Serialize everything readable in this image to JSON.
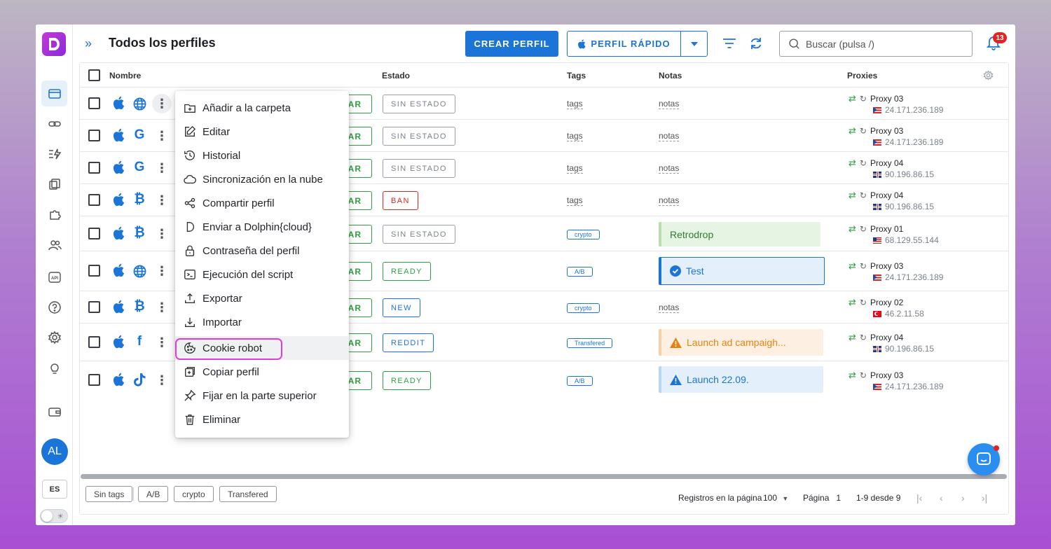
{
  "header": {
    "title": "Todos los perfiles",
    "create_label": "CREAR PERFIL",
    "quick_label": "PERFIL RÁPIDO",
    "search_placeholder": "Buscar (pulsa /)",
    "notifications": "13"
  },
  "sidebar": {
    "avatar": "AL",
    "lang": "ES"
  },
  "columns": {
    "name": "Nombre",
    "status": "Estado",
    "tags": "Tags",
    "notes": "Notas",
    "proxies": "Proxies"
  },
  "start_label": "AR",
  "rows": [
    {
      "site": "globe",
      "status": "SIN ESTADO",
      "tags": "tags",
      "notes": "notas",
      "proxy": "Proxy 03",
      "ip": "24.171.236.189",
      "flag": "pr"
    },
    {
      "site": "google",
      "status": "SIN ESTADO",
      "tags": "tags",
      "notes": "notas",
      "proxy": "Proxy 03",
      "ip": "24.171.236.189",
      "flag": "pr"
    },
    {
      "site": "google",
      "status": "SIN ESTADO",
      "tags": "tags",
      "notes": "notas",
      "proxy": "Proxy 04",
      "ip": "90.196.86.15",
      "flag": "uk"
    },
    {
      "site": "bitcoin",
      "status": "BAN",
      "tags": "tags",
      "notes": "notas",
      "proxy": "Proxy 04",
      "ip": "90.196.86.15",
      "flag": "uk"
    },
    {
      "site": "bitcoin",
      "status": "SIN ESTADO",
      "tags": "crypto",
      "notes": "Retrodrop",
      "proxy": "Proxy 01",
      "ip": "68.129.55.144",
      "flag": "us"
    },
    {
      "site": "globe",
      "status": "READY",
      "tags": "A/B",
      "notes": "Test",
      "proxy": "Proxy 03",
      "ip": "24.171.236.189",
      "flag": "pr"
    },
    {
      "site": "bitcoin",
      "status": "NEW",
      "tags": "crypto",
      "notes": "notas",
      "proxy": "Proxy 02",
      "ip": "46.2.11.58",
      "flag": "tr"
    },
    {
      "site": "facebook",
      "status": "REDDIT",
      "tags": "Transfered",
      "notes": "Launch ad campaigh...",
      "proxy": "Proxy 04",
      "ip": "90.196.86.15",
      "flag": "uk"
    },
    {
      "site": "tiktok",
      "status": "READY",
      "tags": "A/B",
      "notes": "Launch 22.09.",
      "proxy": "Proxy 03",
      "ip": "24.171.236.189",
      "flag": "pr"
    }
  ],
  "menu": [
    "Añadir a la carpeta",
    "Editar",
    "Historial",
    "Sincronización en la nube",
    "Compartir perfil",
    "Enviar a Dolphin{cloud}",
    "Contraseña del perfil",
    "Ejecución del script",
    "Exportar",
    "Importar",
    "Cookie robot",
    "Copiar perfil",
    "Fijar en la parte superior",
    "Eliminar"
  ],
  "footer": {
    "chips": [
      "Sin tags",
      "A/B",
      "crypto",
      "Transfered"
    ],
    "per_page_label": "Registros en la página",
    "per_page": "100",
    "page_label": "Página",
    "page": "1",
    "range": "1-9 desde 9"
  },
  "colors": {
    "accent": "#1b74d8",
    "green": "#2ea043",
    "red": "#e02424",
    "highlight": "#e23bd8"
  }
}
